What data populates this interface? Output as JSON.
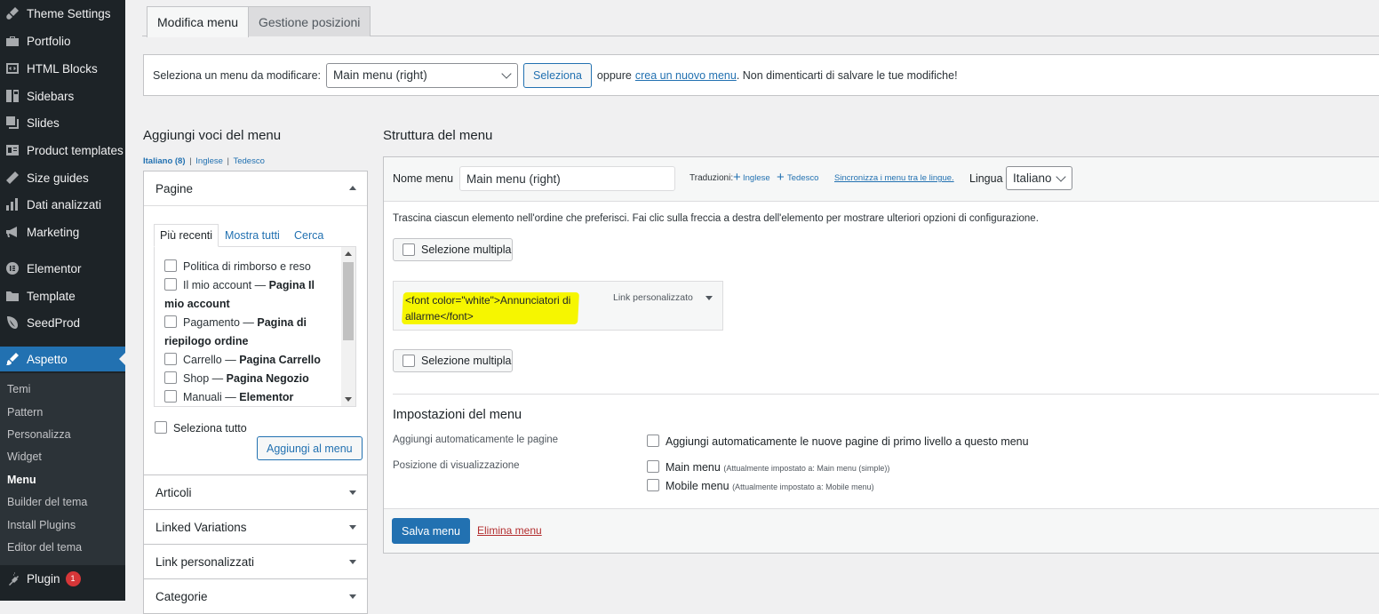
{
  "sidebar": {
    "items": [
      {
        "label": "Theme Settings",
        "icon": "brush-icon"
      },
      {
        "label": "Portfolio",
        "icon": "portfolio-icon"
      },
      {
        "label": "HTML Blocks",
        "icon": "code-icon"
      },
      {
        "label": "Sidebars",
        "icon": "sidebar-icon"
      },
      {
        "label": "Slides",
        "icon": "slides-icon"
      },
      {
        "label": "Product templates",
        "icon": "template-icon"
      },
      {
        "label": "Size guides",
        "icon": "ruler-icon"
      },
      {
        "label": "Dati analizzati",
        "icon": "chart-icon"
      },
      {
        "label": "Marketing",
        "icon": "megaphone-icon"
      },
      {
        "label": "Elementor",
        "icon": "elementor-icon"
      },
      {
        "label": "Template",
        "icon": "folder-icon"
      },
      {
        "label": "SeedProd",
        "icon": "seed-icon"
      },
      {
        "label": "Aspetto",
        "icon": "paintbrush-icon"
      }
    ],
    "submenu": [
      "Temi",
      "Pattern",
      "Personalizza",
      "Widget",
      "Menu",
      "Builder del tema",
      "Install Plugins",
      "Editor del tema"
    ],
    "plugin": {
      "label": "Plugin",
      "badge": "1"
    }
  },
  "tabs": {
    "edit": "Modifica menu",
    "locations": "Gestione posizioni"
  },
  "select_bar": {
    "label": "Seleziona un menu da modificare:",
    "selected": "Main menu (right)",
    "button": "Seleziona",
    "oppure": "oppure",
    "create_link": "crea un nuovo menu",
    "reminder": ". Non dimenticarti di salvare le tue modifiche!"
  },
  "left": {
    "title": "Aggiungi voci del menu",
    "langs": {
      "current": "Italiano (8)",
      "sep": "|",
      "en": "Inglese",
      "de": "Tedesco"
    },
    "pages_title": "Pagine",
    "subtabs": {
      "recent": "Più recenti",
      "all": "Mostra tutti",
      "search": "Cerca"
    },
    "pages": [
      {
        "name": "Politica di rimborso e reso",
        "sep": "",
        "type": ""
      },
      {
        "name": "Il mio account",
        "sep": " — ",
        "type": "Pagina Il mio account"
      },
      {
        "name": "Pagamento",
        "sep": " — ",
        "type": "Pagina di riepilogo ordine"
      },
      {
        "name": "Carrello",
        "sep": " — ",
        "type": "Pagina Carrello"
      },
      {
        "name": "Shop",
        "sep": " — ",
        "type": "Pagina Negozio"
      },
      {
        "name": "Manuali",
        "sep": " — ",
        "type": "Elementor"
      }
    ],
    "select_all": "Seleziona tutto",
    "add_button": "Aggiungi al menu",
    "sections": [
      "Articoli",
      "Linked Variations",
      "Link personalizzati",
      "Categorie"
    ]
  },
  "right": {
    "title": "Struttura del menu",
    "name_label": "Nome menu",
    "name_value": "Main menu (right)",
    "translations_label": "Traduzioni:",
    "trans_en": "Inglese",
    "trans_de": "Tedesco",
    "sync_link": "Sincronizza i menu tra le lingue.",
    "lang_label": "Lingua",
    "lang_value": "Italiano",
    "instructions": "Trascina ciascun elemento nell'ordine che preferisci. Fai clic sulla freccia a destra dell'elemento per mostrare ulteriori opzioni di configurazione.",
    "multi_select": "Selezione multipla",
    "menu_item": {
      "title": "<font color=\"white\">Annunciatori di allarme</font>",
      "type": "Link personalizzato"
    },
    "settings_title": "Impostazioni del menu",
    "auto_add_label": "Aggiungi automaticamente le pagine",
    "auto_add_option": "Aggiungi automaticamente le nuove pagine di primo livello a questo menu",
    "position_label": "Posizione di visualizzazione",
    "locations": [
      {
        "name": "Main menu",
        "note": "(Attualmente impostato a: Main menu (simple))"
      },
      {
        "name": "Mobile menu",
        "note": "(Attualmente impostato a: Mobile menu)"
      }
    ],
    "save_button": "Salva menu",
    "delete_link": "Elimina menu"
  },
  "colors": {
    "accent": "#2271b1",
    "sidebar_bg": "#1d2327",
    "highlight": "#f6f600",
    "danger": "#b32d2e"
  }
}
